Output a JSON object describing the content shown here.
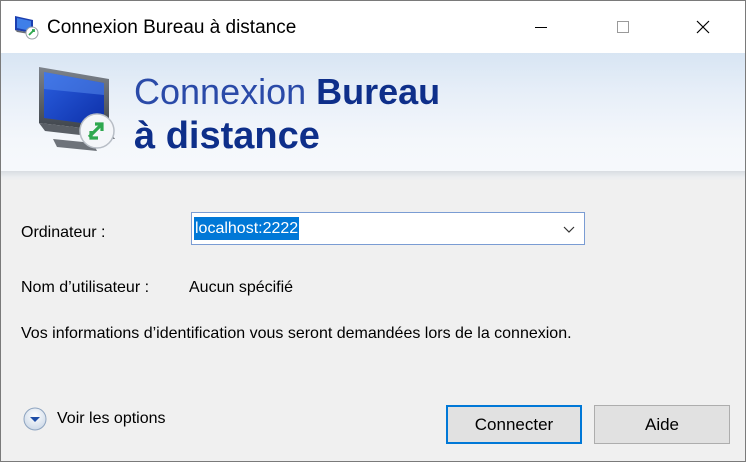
{
  "window": {
    "title": "Connexion Bureau à distance"
  },
  "banner": {
    "title_part1": "Connexion ",
    "title_part2": "Bureau",
    "title_line2": "à distance"
  },
  "form": {
    "computer_label": "Ordinateur :",
    "computer_value": "localhost:2222",
    "username_label": "Nom d’utilisateur :",
    "username_value": "Aucun spécifié",
    "info_text": "Vos informations d’identification vous seront demandées lors de la connexion."
  },
  "options": {
    "label": "Voir les options",
    "icon": "chevron-down-circle-icon"
  },
  "buttons": {
    "connect": "Connecter",
    "help": "Aide"
  },
  "colors": {
    "accent": "#0078d7",
    "title_blue": "#0e2f8a"
  }
}
